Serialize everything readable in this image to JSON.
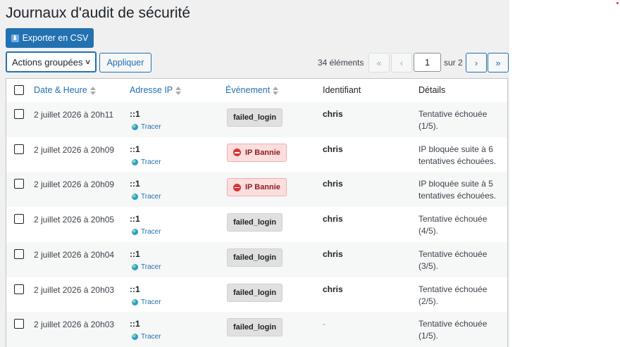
{
  "page": {
    "title": "Journaux d'audit de sécurité",
    "export_label": "Exporter en CSV"
  },
  "toolbar": {
    "bulk_actions": "Actions groupées",
    "apply_label": "Appliquer",
    "items_count": "34 éléments",
    "first": "«",
    "prev": "‹",
    "current_page": "1",
    "of_pages": "sur 2",
    "next": "›",
    "last": "»"
  },
  "table": {
    "headers": {
      "datetime": "Date & Heure",
      "ip": "Adresse IP",
      "event": "Événement",
      "identifier": "Identifiant",
      "details": "Détails"
    },
    "trace_label": "Tracer",
    "rows": [
      {
        "datetime": "2 juillet 2026 à 20h11",
        "ip": "::1",
        "event": "failed_login",
        "identifier": "chris",
        "details": "Tentative échouée (1/5)."
      },
      {
        "datetime": "2 juillet 2026 à 20h09",
        "ip": "::1",
        "event": "IP Bannie",
        "identifier": "chris",
        "details": "IP bloquée suite à 6 tentatives échouées."
      },
      {
        "datetime": "2 juillet 2026 à 20h09",
        "ip": "::1",
        "event": "IP Bannie",
        "identifier": "chris",
        "details": "IP bloquée suite à 5 tentatives échouées."
      },
      {
        "datetime": "2 juillet 2026 à 20h05",
        "ip": "::1",
        "event": "failed_login",
        "identifier": "chris",
        "details": "Tentative échouée (4/5)."
      },
      {
        "datetime": "2 juillet 2026 à 20h04",
        "ip": "::1",
        "event": "failed_login",
        "identifier": "chris",
        "details": "Tentative échouée (3/5)."
      },
      {
        "datetime": "2 juillet 2026 à 20h03",
        "ip": "::1",
        "event": "failed_login",
        "identifier": "chris",
        "details": "Tentative échouée (2/5)."
      },
      {
        "datetime": "2 juillet 2026 à 20h03",
        "ip": "::1",
        "event": "failed_login",
        "identifier": "-",
        "details": "Tentative échouée (1/5)."
      }
    ]
  },
  "colors": {
    "primary": "#2271b1",
    "ban_bg": "#fcdede",
    "ban_text": "#8a1f1f",
    "badge_gray": "#e0e0e0"
  },
  "icons": {
    "export": "download-icon",
    "sort": "sort-icon",
    "trace": "globe-icon",
    "ban": "ban-icon",
    "select": "chevron-down-icon"
  }
}
